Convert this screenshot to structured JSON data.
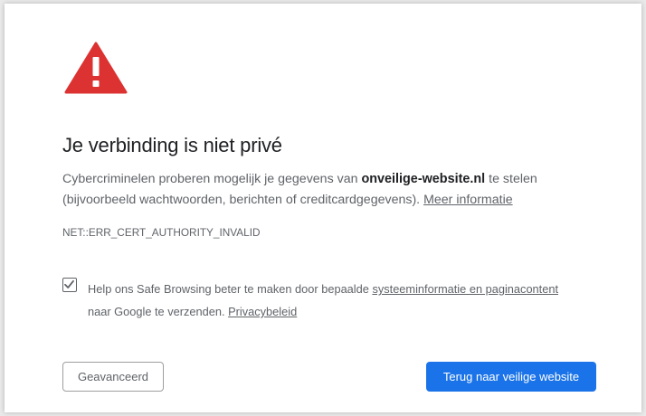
{
  "colors": {
    "warning_icon": "#dc3232",
    "primary_button": "#1a73e8",
    "text_primary": "#202124",
    "text_secondary": "#5f6368"
  },
  "icon": "warning-triangle-icon",
  "title": "Je verbinding is niet privé",
  "description": {
    "before_domain": "Cybercriminelen proberen mogelijk je gegevens van ",
    "domain": "onveilige-website.nl",
    "after_domain": " te stelen",
    "line2": "(bijvoorbeeld wachtwoorden, berichten of creditcardgegevens). ",
    "more_info_link": "Meer informatie"
  },
  "error_code": "NET::ERR_CERT_AUTHORITY_INVALID",
  "safe_browsing": {
    "checked": true,
    "text_before_link": "Help ons Safe Browsing beter te maken door bepaalde ",
    "link": "systeeminformatie en paginacontent",
    "text_line2": "naar Google te verzenden. ",
    "privacy_link": "Privacybeleid"
  },
  "buttons": {
    "advanced": "Geavanceerd",
    "back_to_safety": "Terug naar veilige website"
  }
}
